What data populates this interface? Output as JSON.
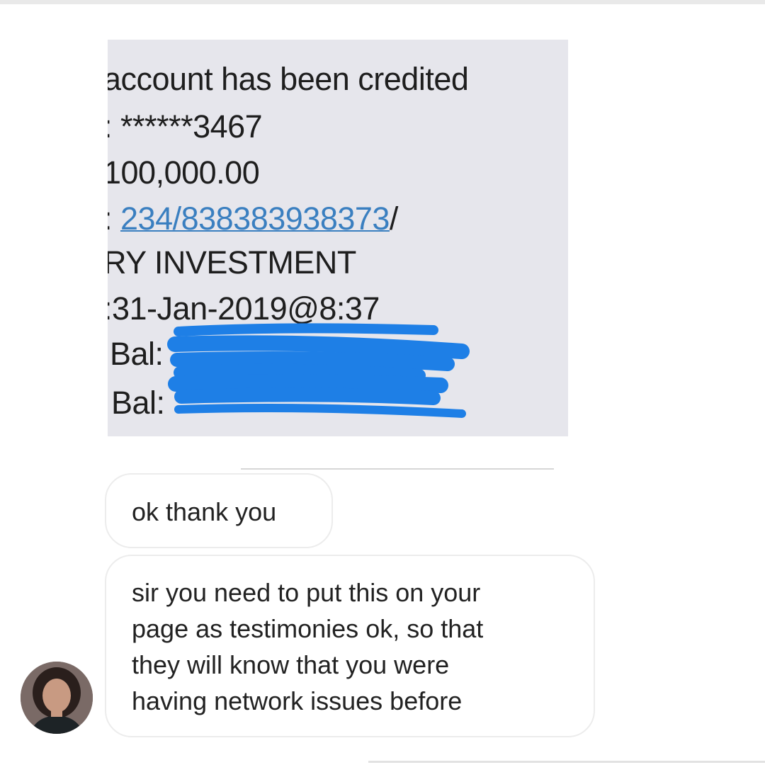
{
  "sms": {
    "line1": "account has been credited",
    "line2": ": ******3467",
    "line3": "100,000.00",
    "line4_prefix": ": ",
    "line4_link": "234/838383938373",
    "line4_suffix": "/",
    "line5": "RY INVESTMENT",
    "line6": ":31-Jan-2019@8:37",
    "line7": "Bal:",
    "line8": "Bal:"
  },
  "messages": [
    {
      "lines": [
        "ok thank you"
      ]
    },
    {
      "lines": [
        "sir you need to put this on your",
        "page as testimonies ok, so that",
        "they will know that you were",
        "having network issues before"
      ]
    }
  ],
  "colors": {
    "redaction": "#1e7fe6",
    "link": "#3a7fc0",
    "sms_bg": "#e6e6ec"
  },
  "icons": {
    "avatar": "contact-avatar-photo"
  }
}
